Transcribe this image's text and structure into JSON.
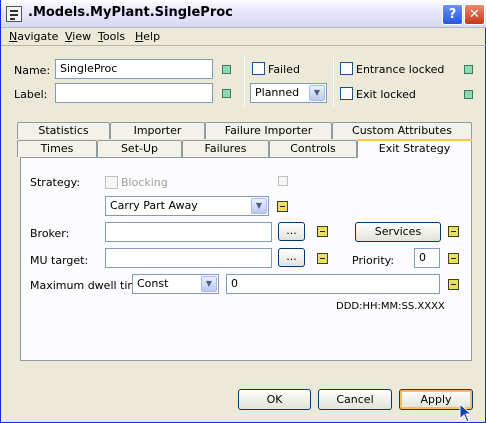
{
  "window": {
    "title": ".Models.MyPlant.SingleProc",
    "help_glyph": "?",
    "close_glyph": "✕"
  },
  "menu": [
    {
      "label": "Navigate",
      "underline": "N",
      "rest": "avigate"
    },
    {
      "label": "View",
      "underline": "V",
      "rest": "iew"
    },
    {
      "label": "Tools",
      "underline": "T",
      "rest": "ools"
    },
    {
      "label": "Help",
      "underline": "H",
      "rest": "elp"
    }
  ],
  "header": {
    "name_label": "Name:",
    "name_value": "SingleProc",
    "label_label": "Label:",
    "label_value": "",
    "failed_label": "Failed",
    "failed_checked": false,
    "status_value": "Planned",
    "entrance_locked_label": "Entrance locked",
    "entrance_locked_checked": false,
    "exit_locked_label": "Exit locked",
    "exit_locked_checked": false
  },
  "tabs_row_back": [
    "Statistics",
    "Importer",
    "Failure Importer",
    "Custom Attributes"
  ],
  "tabs_row_front": [
    "Times",
    "Set-Up",
    "Failures",
    "Controls",
    "Exit Strategy"
  ],
  "active_tab": "Exit Strategy",
  "exit_strategy": {
    "strategy_label": "Strategy:",
    "blocking_label": "Blocking",
    "blocking_checked": false,
    "strategy_value": "Carry Part Away",
    "broker_label": "Broker:",
    "broker_value": "",
    "browse_label": "...",
    "services_label": "Services",
    "mu_target_label": "MU target:",
    "mu_target_value": "",
    "priority_label": "Priority:",
    "priority_value": "0",
    "max_dwell_label": "Maximum dwell time:",
    "max_dwell_dist": "Const",
    "max_dwell_value": "0",
    "time_format": "DDD:HH:MM:SS.XXXX"
  },
  "buttons": {
    "ok": "OK",
    "cancel": "Cancel",
    "apply": "Apply"
  },
  "colors": {
    "accent_tab": "#ffc83c",
    "inheritance_green": "#8fd9b6",
    "inheritance_yellow": "#e8e060",
    "titlebar_close": "#c4391a"
  }
}
